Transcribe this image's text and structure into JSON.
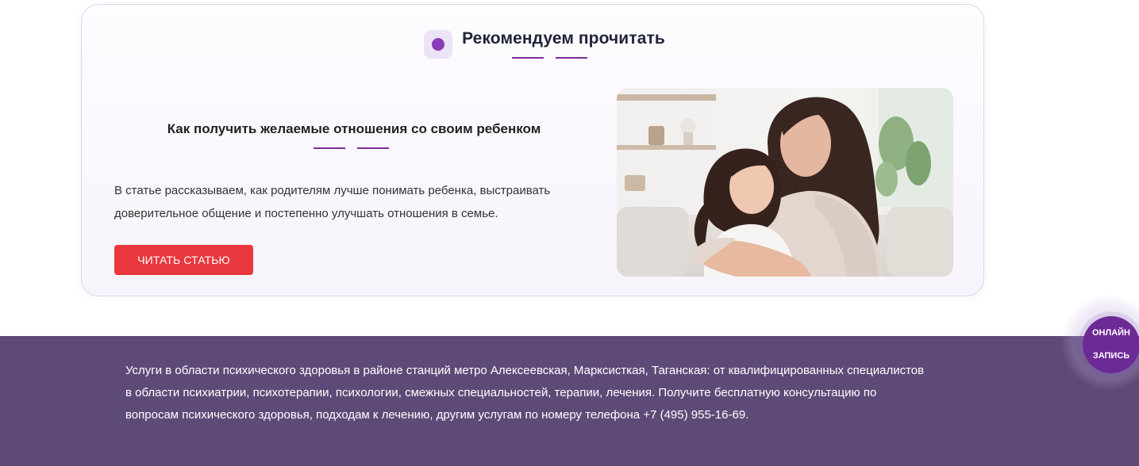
{
  "recommend": {
    "title": "Рекомендуем прочитать",
    "icon": "dot-icon",
    "accent_color": "#7a2e94"
  },
  "article": {
    "title": "Как получить желаемые отношения со своим ребенком",
    "description": "В статье рассказываем, как родителям лучше понимать ребенка, выстраивать доверительное общение и постепенно улучшать отношения в семье.",
    "button_label": "ЧИТАТЬ СТАТЬЮ",
    "button_color": "#e8373d",
    "image": "mother-and-daughter-photo"
  },
  "footer": {
    "text": "Услуги в области психического здоровья в районе станций метро Алексеевская, Марксисткая, Таганская: от квалифицированных специалистов в области психиатрии, психотерапии, психологии, смежных специальностей, терапии, лечения. Получите бесплатную консультацию по вопросам психического здоровья, подходам к лечению, другим услугам по номеру телефона +7 (495) 955-16-69.",
    "background": "#5e4a77"
  },
  "online_booking": {
    "line1": "ОНЛАЙН",
    "line2": "ЗАПИСЬ",
    "color": "#6c2a96"
  }
}
